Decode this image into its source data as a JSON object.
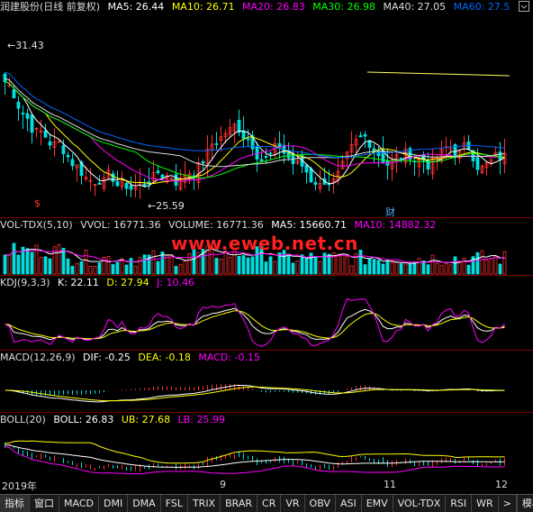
{
  "main_panel": {
    "title": "润建股份(日线 前复权)",
    "ma": [
      {
        "label": "MA5: 26.44",
        "color": "#ffffff"
      },
      {
        "label": "MA10: 26.71",
        "color": "#ffff00"
      },
      {
        "label": "MA20: 26.83",
        "color": "#ff00ff"
      },
      {
        "label": "MA30: 26.98",
        "color": "#00ff00"
      },
      {
        "label": "MA40: 27.05",
        "color": "#dddddd"
      },
      {
        "label": "MA60: 27.5",
        "color": "#0066ff"
      }
    ],
    "high_label": "31.43",
    "low_label": "25.59",
    "marker_s": "$",
    "marker_cai": "财"
  },
  "volume_panel": {
    "name": "VOL-TDX(5,10)",
    "vvol": "VVOL: 16771.36",
    "volume": "VOLUME: 16771.36",
    "ma5": "MA5: 15660.71",
    "ma10": "MA10: 14882.32"
  },
  "kdj_panel": {
    "name": "KDJ(9,3,3)",
    "k": "K: 22.11",
    "d": "D: 27.94",
    "j": "J: 10.46"
  },
  "macd_panel": {
    "name": "MACD(12,26,9)",
    "dif": "DIF: -0.25",
    "dea": "DEA: -0.18",
    "macd": "MACD: -0.15"
  },
  "boll_panel": {
    "name": "BOLL(20)",
    "boll": "BOLL: 26.83",
    "ub": "UB: 27.68",
    "lb": "LB: 25.99"
  },
  "watermark": "www.eweb.net.cn",
  "x_axis": {
    "labels": [
      "2019年",
      "9",
      "11",
      "12"
    ]
  },
  "tabs": [
    "指标",
    "窗口",
    "MACD",
    "DMI",
    "DMA",
    "FSL",
    "TRIX",
    "BRAR",
    "CR",
    "VR",
    "OBV",
    "ASI",
    "EMV",
    "VOL-TDX",
    "RSI",
    "WR",
    ">"
  ],
  "tab_right": "模板",
  "colors": {
    "up": "#ff3030",
    "down": "#00e0e0",
    "separator": "#7a0000"
  }
}
